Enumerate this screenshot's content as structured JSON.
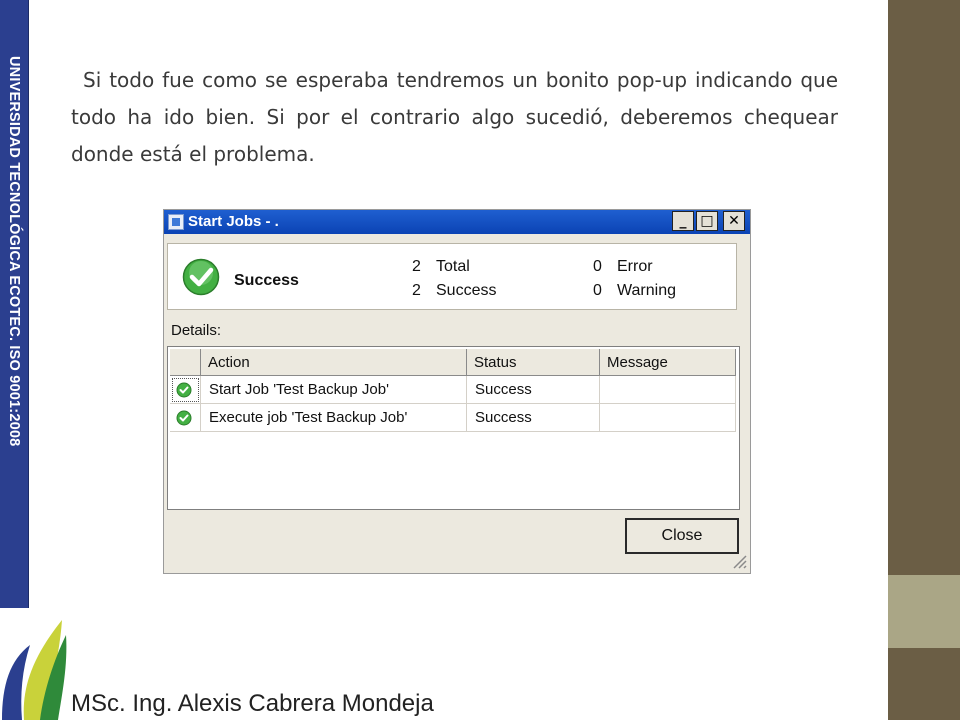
{
  "slide": {
    "side_banner": "UNIVERSIDAD TECNOLÓGICA ECOTEC. ISO 9001:2008",
    "paragraph": "Si todo fue como se esperaba tendremos un bonito pop-up indicando que todo ha ido bien. Si por el contrario algo sucedió, deberemos chequear donde está el problema.",
    "footer_author": "MSc. Ing. Alexis Cabrera Mondeja"
  },
  "dialog": {
    "title": "Start Jobs - .",
    "window_buttons": {
      "minimize": "_",
      "maximize": "□",
      "close": "✕"
    },
    "summary": {
      "status": "Success",
      "total_count": "2",
      "total_label": "Total",
      "success_count": "2",
      "success_label": "Success",
      "error_count": "0",
      "error_label": "Error",
      "warning_count": "0",
      "warning_label": "Warning"
    },
    "details_label": "Details:",
    "columns": [
      "Action",
      "Status",
      "Message"
    ],
    "rows": [
      {
        "icon": "success-check-icon",
        "action": "Start Job 'Test Backup Job'",
        "status": "Success",
        "message": ""
      },
      {
        "icon": "success-check-icon",
        "action": "Execute job 'Test Backup Job'",
        "status": "Success",
        "message": ""
      }
    ],
    "close_label": "Close"
  },
  "colors": {
    "side_banner": "#2b3f8f",
    "right_panel_dark": "#6b5e45",
    "right_panel_light": "#aaa686",
    "titlebar": "#0b43b4",
    "success_green": "#3aa83a"
  }
}
